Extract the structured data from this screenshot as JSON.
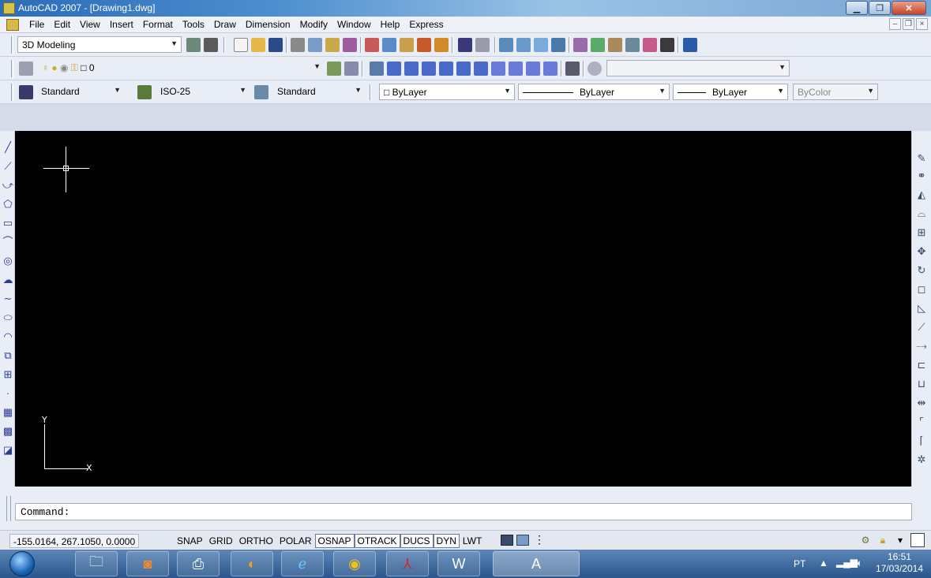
{
  "window": {
    "title": "AutoCAD 2007 - [Drawing1.dwg]"
  },
  "menu": [
    "File",
    "Edit",
    "View",
    "Insert",
    "Format",
    "Tools",
    "Draw",
    "Dimension",
    "Modify",
    "Window",
    "Help",
    "Express"
  ],
  "toolbar1": {
    "workspace": "3D Modeling"
  },
  "toolbar2": {
    "layer": "0",
    "layer_extra": ""
  },
  "toolbar3": {
    "text_style": "Standard",
    "dim_style": "ISO-25",
    "table_style": "Standard",
    "color": "ByLayer",
    "linetype": "ByLayer",
    "lineweight": "ByLayer",
    "plotstyle": "ByColor"
  },
  "ucs": {
    "x_label": "X",
    "y_label": "Y"
  },
  "command": {
    "prompt": "Command:"
  },
  "status": {
    "coords": "-155.0164, 267.1050, 0.0000",
    "buttons": [
      {
        "label": "SNAP",
        "on": false
      },
      {
        "label": "GRID",
        "on": false
      },
      {
        "label": "ORTHO",
        "on": false
      },
      {
        "label": "POLAR",
        "on": false
      },
      {
        "label": "OSNAP",
        "on": true
      },
      {
        "label": "OTRACK",
        "on": true
      },
      {
        "label": "DUCS",
        "on": true
      },
      {
        "label": "DYN",
        "on": true
      },
      {
        "label": "LWT",
        "on": false
      }
    ]
  },
  "taskbar": {
    "language": "PT",
    "time": "16:51",
    "date": "17/03/2014"
  },
  "colors": {
    "canvas": "#000000",
    "titlebar": "#2a6cb8"
  }
}
